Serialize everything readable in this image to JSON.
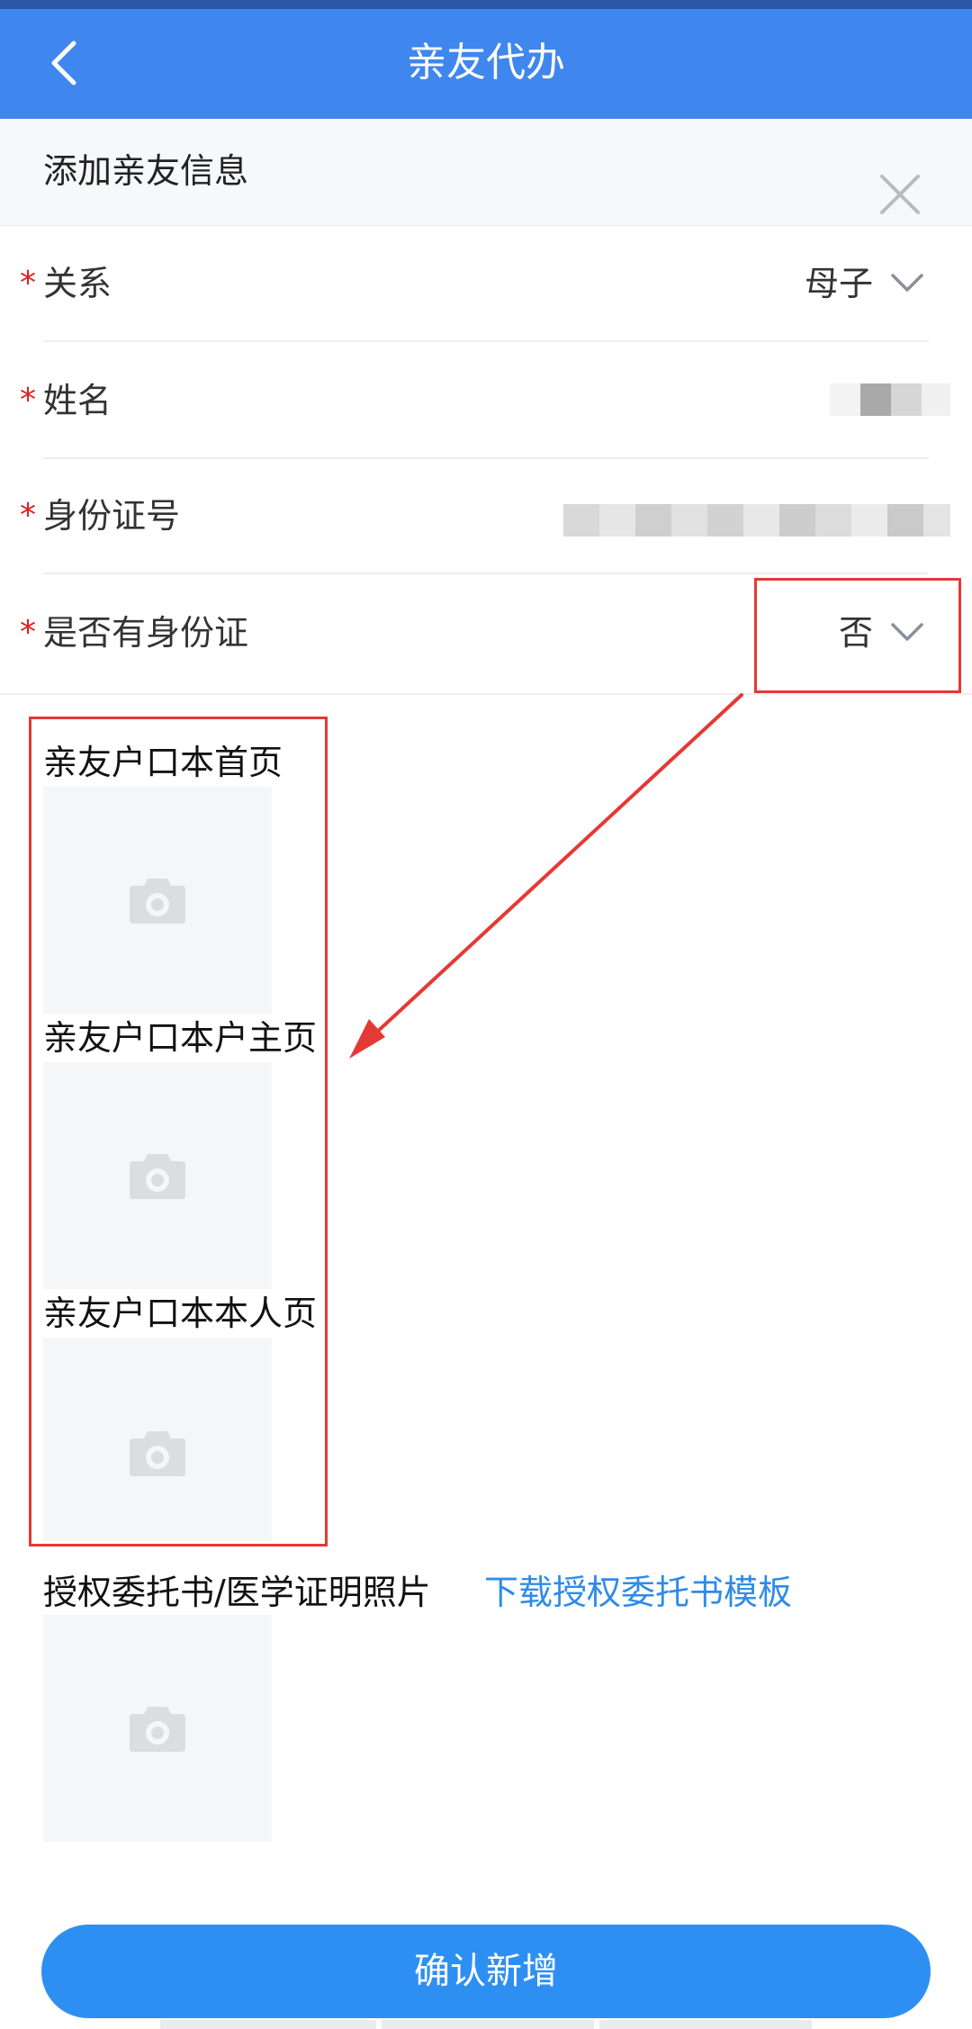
{
  "header": {
    "title": "亲友代办",
    "back_icon": "chevron-left-icon"
  },
  "panel": {
    "title": "添加亲友信息",
    "close_icon": "close-icon"
  },
  "form": {
    "required_mark": "*",
    "rows": [
      {
        "label": "关系",
        "value": "母子",
        "icon": "chevron-down-icon"
      },
      {
        "label": "姓名",
        "value": ""
      },
      {
        "label": "身份证号",
        "value": ""
      },
      {
        "label": "是否有身份证",
        "value": "否",
        "icon": "chevron-down-icon"
      }
    ]
  },
  "uploads": [
    {
      "label": "亲友户口本首页",
      "icon": "camera-icon"
    },
    {
      "label": "亲友户口本户主页",
      "icon": "camera-icon"
    },
    {
      "label": "亲友户口本本人页",
      "icon": "camera-icon"
    },
    {
      "label": "授权委托书/医学证明照片",
      "icon": "camera-icon"
    }
  ],
  "download_link": "下载授权委托书模板",
  "confirm_button": "确认新增",
  "colors": {
    "header_bg": "#3f86ee",
    "button_bg": "#2e8ff2",
    "link": "#2f8be8",
    "required": "#e02020",
    "annotation": "#e53935"
  }
}
